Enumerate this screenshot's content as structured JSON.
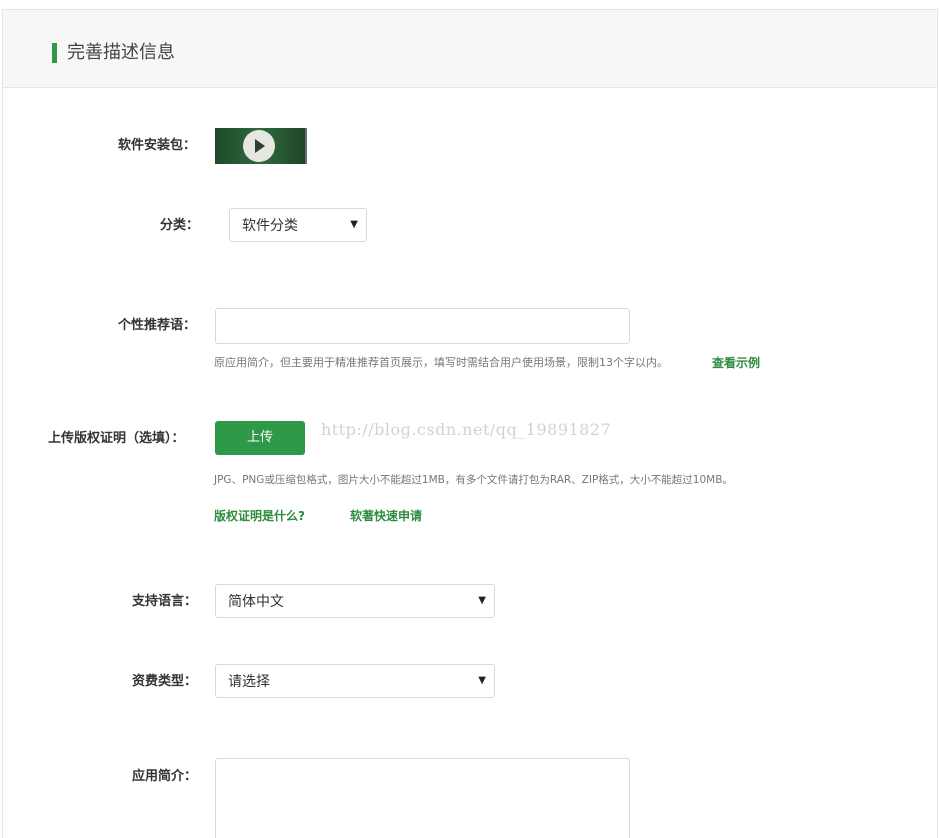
{
  "header": {
    "title": "完善描述信息",
    "accent_color": "#2e9a48"
  },
  "package": {
    "label": "软件安装包：",
    "thumb_icon": "play-icon"
  },
  "category": {
    "label": "分类：",
    "value": "软件分类"
  },
  "recommend": {
    "label": "个性推荐语：",
    "value": "",
    "hint": "原应用简介，但主要用于精准推荐首页展示，填写时需结合用户使用场景，限制13个字以内。",
    "example_link": "查看示例"
  },
  "copyright": {
    "label": "上传版权证明（选填）：",
    "upload_label": "上传",
    "watermark": "http://blog.csdn.net/qq_19891827",
    "hint": "JPG、PNG或压缩包格式，图片大小不能超过1MB，有多个文件请打包为RAR、ZIP格式，大小不能超过10MB。",
    "link_what": "版权证明是什么?",
    "link_apply": "软著快速申请"
  },
  "language": {
    "label": "支持语言：",
    "value": "简体中文"
  },
  "fee": {
    "label": "资费类型：",
    "value": "请选择"
  },
  "intro": {
    "label": "应用简介：",
    "value": ""
  },
  "colors": {
    "brand_green": "#2e9a48",
    "link_green": "#2e8c3e"
  }
}
